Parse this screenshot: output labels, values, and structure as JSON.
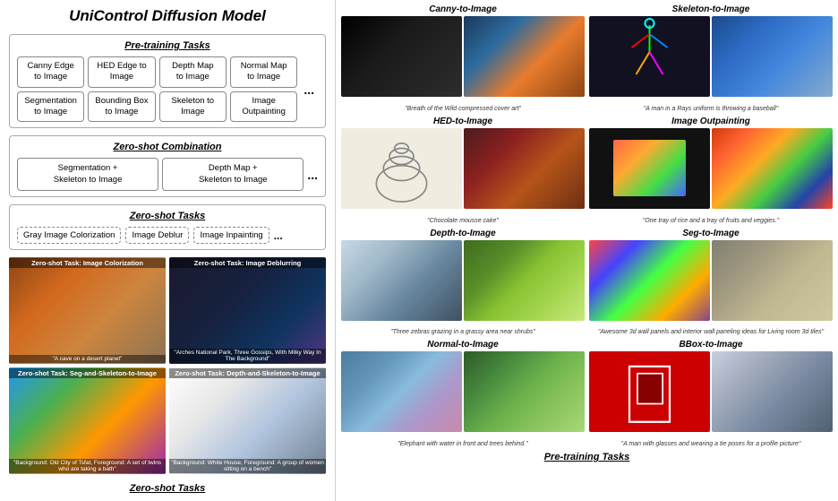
{
  "left": {
    "main_title": "UniControl Diffusion Model",
    "pretraining": {
      "section_title": "Pre-training Tasks",
      "tasks": [
        {
          "label": "Canny Edge\nto Image"
        },
        {
          "label": "HED Edge to\nImage"
        },
        {
          "label": "Depth Map\nto Image"
        },
        {
          "label": "Normal Map\nto Image"
        },
        {
          "label": "Segmentation\nto Image"
        },
        {
          "label": "Bounding Box\nto Image"
        },
        {
          "label": "Skeleton to\nImage"
        },
        {
          "label": "Image\nOutpainting"
        }
      ],
      "dots": "..."
    },
    "zeroshot_combo": {
      "section_title": "Zero-shot Combination",
      "items": [
        {
          "label": "Segmentation +\nSkeleton to Image"
        },
        {
          "label": "Depth Map +\nSkeleton to Image"
        }
      ],
      "dots": "..."
    },
    "zeroshot_tasks": {
      "section_title": "Zero-shot Tasks",
      "items": [
        {
          "label": "Gray Image Colorization"
        },
        {
          "label": "Image Deblur"
        },
        {
          "label": "Image Inpainting"
        },
        {
          "label": "..."
        }
      ]
    },
    "screenshots": [
      {
        "label_top": "Zero-shot Task: Image Colorization",
        "label_bottom": "\"A cave on a desert planet\"",
        "img_class": "img-colorization"
      },
      {
        "label_top": "Zero-shot Task: Image Deblurring",
        "label_bottom": "\"Arches National Park, Three Gossips, With Milky Way In The Background\"",
        "img_class": "img-deblur"
      },
      {
        "label_top": "Zero-shot Task: Seg-and-Skeleton-to-Image",
        "label_bottom": "\"Background: Old City of Tsfat, Foreground: A set of twins who are taking a bath\"",
        "img_class": "img-seg-skel"
      },
      {
        "label_top": "Zero-shot Task: Depth-and-Skeleton-to-Image",
        "label_bottom": "\"Background: White House, Foreground: A group of women sitting on a bench\"",
        "img_class": "img-depth-skel"
      }
    ],
    "bottom_title": "Zero-shot Tasks"
  },
  "right": {
    "sections": [
      {
        "id": "canny",
        "title": "Canny-to-Image",
        "caption": "\"Breath of the Wild compressed cover art\"",
        "img1_class": "canny-input",
        "img2_class": "canny-output"
      },
      {
        "id": "skeleton",
        "title": "Skeleton-to-Image",
        "caption": "\"A man in a Rays uniform is throwing a baseball\"",
        "img1_class": "skeleton-input",
        "img2_class": "skeleton-output"
      },
      {
        "id": "hed",
        "title": "HED-to-Image",
        "caption": "\"Chocolate mousse cake\"",
        "img1_class": "hed-input",
        "img2_class": "hed-output"
      },
      {
        "id": "outpainting",
        "title": "Image Outpainting",
        "caption": "\"One tray of rice and a tray of fruits and veggies.\"",
        "img1_class": "outpainting-input",
        "img2_class": "outpainting-output"
      },
      {
        "id": "depth",
        "title": "Depth-to-Image",
        "caption": "\"Three zebras grazing in a grassy area near shrubs\"",
        "img1_class": "depth-input",
        "img2_class": "depth-output"
      },
      {
        "id": "seg",
        "title": "Seg-to-Image",
        "caption": "\"Awesome 3d wall panels and interior wall paneling ideas for Living room 3d tiles\"",
        "img1_class": "seg-input",
        "img2_class": "seg-output"
      },
      {
        "id": "normal",
        "title": "Normal-to-Image",
        "caption": "\"Elephant with water in front and trees behind.\"",
        "img1_class": "normal-input",
        "img2_class": "normal-output"
      },
      {
        "id": "bbox",
        "title": "BBox-to-Image",
        "caption": "\"A man with glasses and wearing a tie poses for a profile picture\"",
        "img1_class": "bbox-input",
        "img2_class": "bbox-output"
      }
    ],
    "bottom_label": "Pre-training Tasks"
  }
}
